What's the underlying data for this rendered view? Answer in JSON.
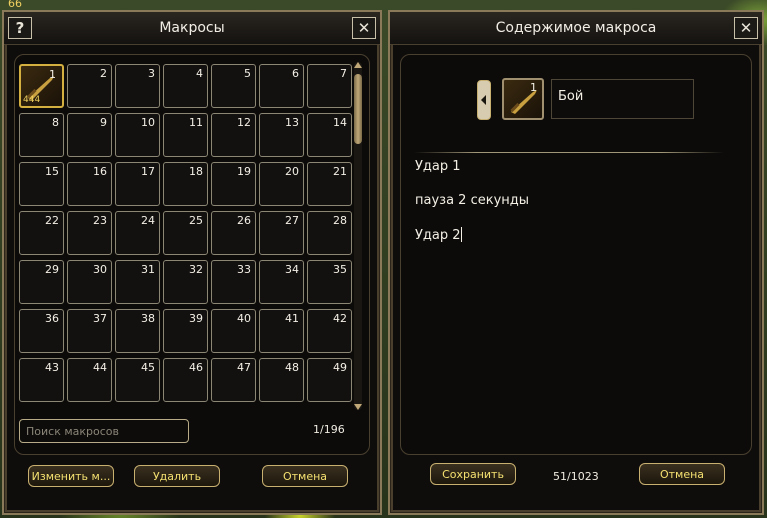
{
  "world": {
    "level_badge": "66"
  },
  "macros_panel": {
    "title": "Макросы",
    "help_icon": "?",
    "close_icon": "✕",
    "slots": [
      {
        "num": "1",
        "tail": "444"
      },
      {
        "num": "2"
      },
      {
        "num": "3"
      },
      {
        "num": "4"
      },
      {
        "num": "5"
      },
      {
        "num": "6"
      },
      {
        "num": "7"
      },
      {
        "num": "8"
      },
      {
        "num": "9"
      },
      {
        "num": "10"
      },
      {
        "num": "11"
      },
      {
        "num": "12"
      },
      {
        "num": "13"
      },
      {
        "num": "14"
      },
      {
        "num": "15"
      },
      {
        "num": "16"
      },
      {
        "num": "17"
      },
      {
        "num": "18"
      },
      {
        "num": "19"
      },
      {
        "num": "20"
      },
      {
        "num": "21"
      },
      {
        "num": "22"
      },
      {
        "num": "23"
      },
      {
        "num": "24"
      },
      {
        "num": "25"
      },
      {
        "num": "26"
      },
      {
        "num": "27"
      },
      {
        "num": "28"
      },
      {
        "num": "29"
      },
      {
        "num": "30"
      },
      {
        "num": "31"
      },
      {
        "num": "32"
      },
      {
        "num": "33"
      },
      {
        "num": "34"
      },
      {
        "num": "35"
      },
      {
        "num": "36"
      },
      {
        "num": "37"
      },
      {
        "num": "38"
      },
      {
        "num": "39"
      },
      {
        "num": "40"
      },
      {
        "num": "41"
      },
      {
        "num": "42"
      },
      {
        "num": "43"
      },
      {
        "num": "44"
      },
      {
        "num": "45"
      },
      {
        "num": "46"
      },
      {
        "num": "47"
      },
      {
        "num": "48"
      },
      {
        "num": "49"
      }
    ],
    "search_placeholder": "Поиск макросов",
    "page_counter": "1/196",
    "edit_button": "Изменить м...",
    "delete_button": "Удалить",
    "cancel_button": "Отмена"
  },
  "content_panel": {
    "title": "Содержимое макроса",
    "close_icon": "✕",
    "icon_num": "1",
    "macro_name": "Бой",
    "lines": [
      "Удар 1",
      "пауза 2 секунды",
      "Удар 2"
    ],
    "save_button": "Сохранить",
    "char_counter": "51/1023",
    "cancel_button": "Отмена"
  },
  "colors": {
    "accent": "#f4e070",
    "frame": "#8a7a5a",
    "active_slot": "#d4b040"
  }
}
